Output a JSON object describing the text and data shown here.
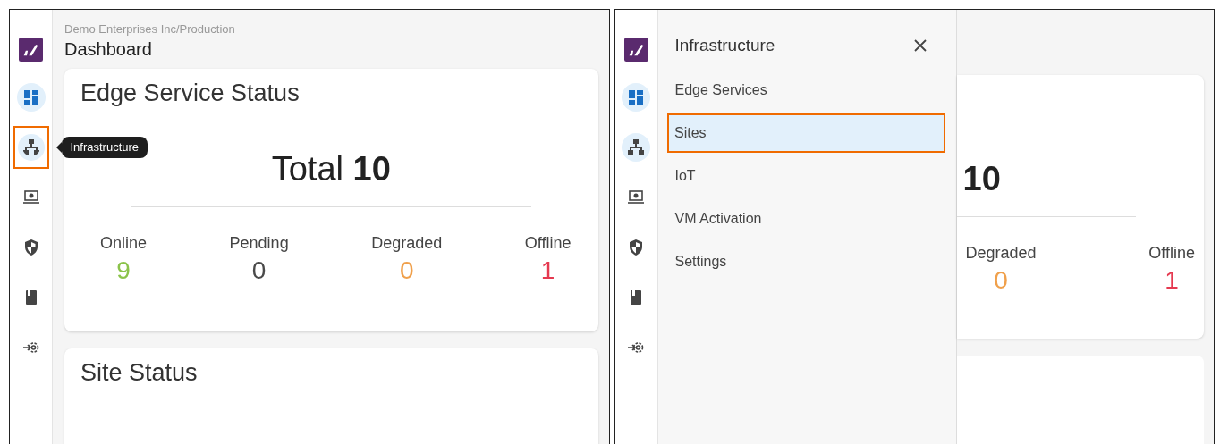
{
  "left": {
    "nav": [
      {
        "kind": "dashboard",
        "selected": true,
        "highlighted": false
      },
      {
        "kind": "infrastructure",
        "selected": true,
        "highlighted": true
      },
      {
        "kind": "devices",
        "selected": false,
        "highlighted": false
      },
      {
        "kind": "security",
        "selected": false,
        "highlighted": false
      },
      {
        "kind": "docs",
        "selected": false,
        "highlighted": false
      },
      {
        "kind": "integrations",
        "selected": false,
        "highlighted": false
      }
    ],
    "tooltip": "Infrastructure",
    "breadcrumb": "Demo Enterprises Inc/Production",
    "title": "Dashboard",
    "cards": [
      {
        "title": "Edge Service Status",
        "total_label": "Total",
        "total": "10",
        "stats": [
          {
            "label": "Online",
            "value": "9",
            "color": "#8bc34a"
          },
          {
            "label": "Pending",
            "value": "0",
            "color": "#4a4a4a"
          },
          {
            "label": "Degraded",
            "value": "0",
            "color": "#f0a04b"
          },
          {
            "label": "Offline",
            "value": "1",
            "color": "#e53950"
          }
        ]
      },
      {
        "title": "Site Status"
      }
    ]
  },
  "right": {
    "nav": [
      {
        "kind": "dashboard",
        "selected": true,
        "highlighted": false
      },
      {
        "kind": "infrastructure",
        "selected": true,
        "highlighted": false
      },
      {
        "kind": "devices",
        "selected": false,
        "highlighted": false
      },
      {
        "kind": "security",
        "selected": false,
        "highlighted": false
      },
      {
        "kind": "docs",
        "selected": false,
        "highlighted": false
      },
      {
        "kind": "integrations",
        "selected": false,
        "highlighted": false
      }
    ],
    "menu": {
      "title": "Infrastructure",
      "items": [
        {
          "label": "Edge Services",
          "selected": false
        },
        {
          "label": "Sites",
          "selected": true
        },
        {
          "label": "IoT",
          "selected": false
        },
        {
          "label": "VM Activation",
          "selected": false
        },
        {
          "label": "Settings",
          "selected": false
        }
      ]
    },
    "card": {
      "total": "10",
      "stats": [
        {
          "label": "Degraded",
          "value": "0",
          "color": "#f0a04b"
        },
        {
          "label": "Offline",
          "value": "1",
          "color": "#e53950"
        }
      ]
    }
  }
}
